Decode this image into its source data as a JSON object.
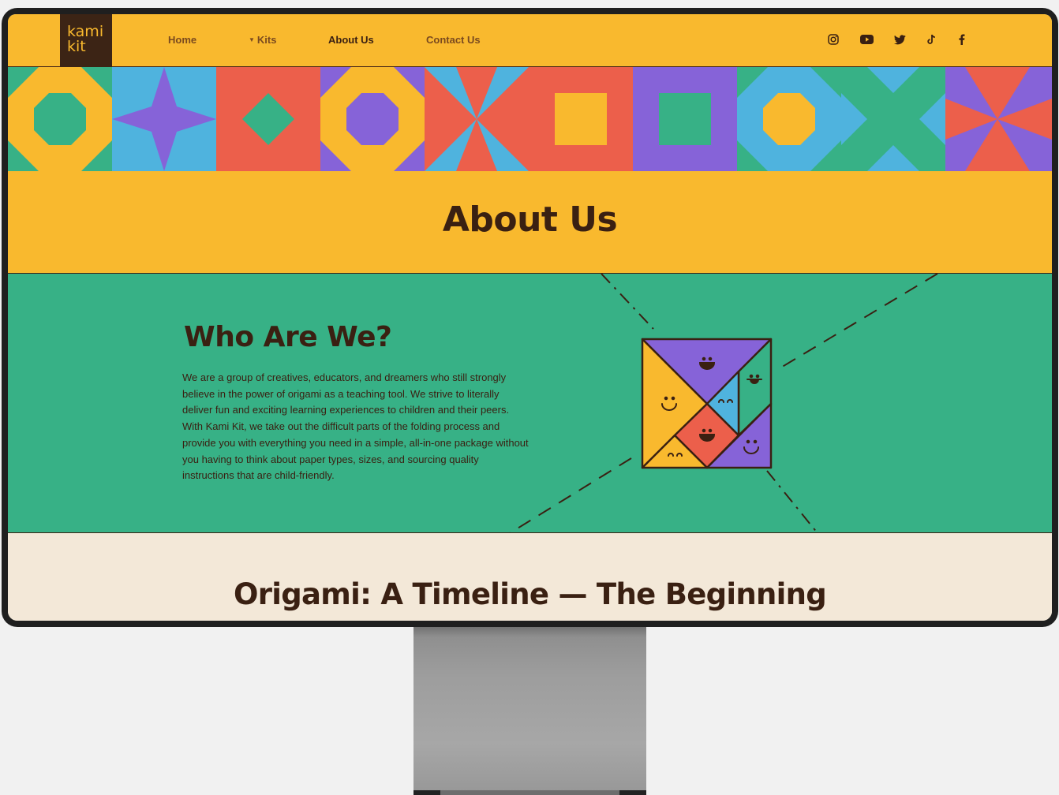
{
  "brand": {
    "logo_line1": "kami",
    "logo_line2": "kit"
  },
  "nav": {
    "links": [
      {
        "label": "Home"
      },
      {
        "label": "Kits",
        "has_dropdown": true
      },
      {
        "label": "About Us",
        "active": true
      },
      {
        "label": "Contact Us"
      }
    ],
    "social": [
      "instagram-icon",
      "youtube-icon",
      "twitter-icon",
      "tiktok-icon",
      "facebook-icon"
    ]
  },
  "colors": {
    "yellow": "#f9b92e",
    "green": "#37b186",
    "blue": "#4fb3de",
    "purple": "#8663d8",
    "red": "#ec5f4b",
    "brown": "#3a2012",
    "cream": "#f3e8d8"
  },
  "hero": {
    "title": "About Us"
  },
  "who": {
    "heading": "Who Are We?",
    "body": "We are a group of creatives, educators, and dreamers who still strongly believe in the power of origami as a teaching tool. We strive to literally deliver fun and exciting learning experiences to children and their peers. With Kami Kit, we take out the difficult parts of the folding process and provide you with everything you need in a simple, all-in-one package without you having to think about paper types, sizes, and sourcing quality instructions that are child-friendly."
  },
  "timeline": {
    "heading": "Origami: A Timeline — The Beginning"
  }
}
